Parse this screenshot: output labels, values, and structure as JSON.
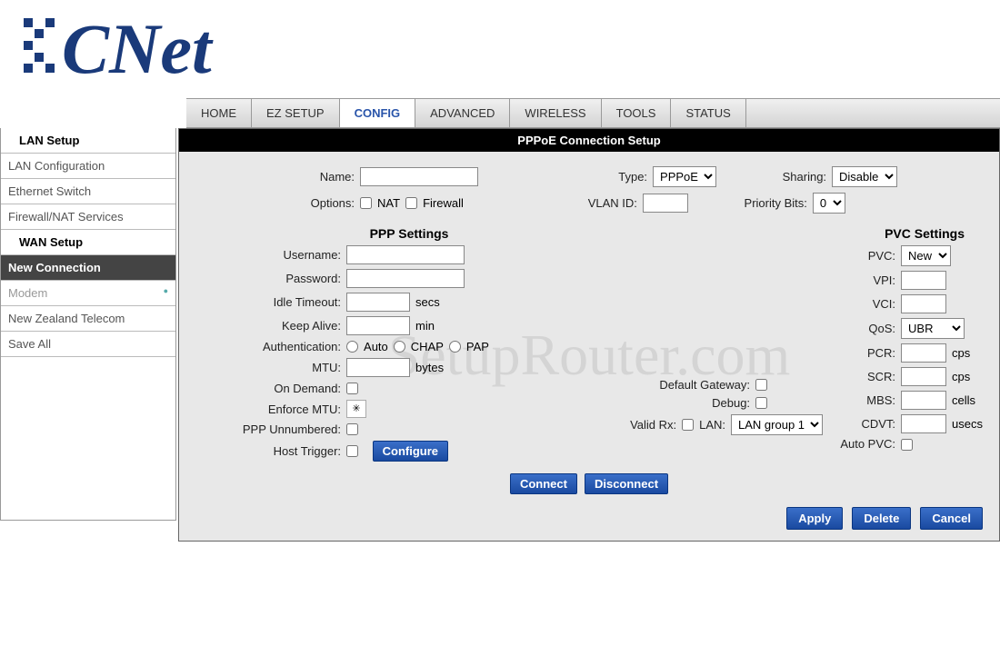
{
  "logo_text": "CNet",
  "nav": [
    "HOME",
    "EZ SETUP",
    "CONFIG",
    "ADVANCED",
    "WIRELESS",
    "TOOLS",
    "STATUS"
  ],
  "nav_active": "CONFIG",
  "sidebar": {
    "lan_hdr": "LAN Setup",
    "items1": [
      "LAN Configuration",
      "Ethernet Switch",
      "Firewall/NAT Services"
    ],
    "wan_hdr": "WAN Setup",
    "active": "New Connection",
    "items2": [
      "Modem",
      "New Zealand Telecom",
      "Save All"
    ]
  },
  "title": "PPPoE Connection Setup",
  "top": {
    "name_lbl": "Name:",
    "name_val": "",
    "type_lbl": "Type:",
    "type_val": "PPPoE",
    "sharing_lbl": "Sharing:",
    "sharing_val": "Disable",
    "options_lbl": "Options:",
    "nat_lbl": "NAT",
    "firewall_lbl": "Firewall",
    "vlan_lbl": "VLAN ID:",
    "vlan_val": "",
    "prio_lbl": "Priority Bits:",
    "prio_val": "0"
  },
  "ppp": {
    "hdr": "PPP Settings",
    "username_lbl": "Username:",
    "username_val": "",
    "password_lbl": "Password:",
    "password_val": "",
    "idle_lbl": "Idle Timeout:",
    "idle_val": "",
    "idle_unit": "secs",
    "keep_lbl": "Keep Alive:",
    "keep_val": "",
    "keep_unit": "min",
    "auth_lbl": "Authentication:",
    "auth_auto": "Auto",
    "auth_chap": "CHAP",
    "auth_pap": "PAP",
    "mtu_lbl": "MTU:",
    "mtu_val": "",
    "mtu_unit": "bytes",
    "ondemand_lbl": "On Demand:",
    "enforce_lbl": "Enforce MTU:",
    "unnum_lbl": "PPP Unnumbered:",
    "host_lbl": "Host Trigger:",
    "configure_btn": "Configure",
    "connect_btn": "Connect",
    "disconnect_btn": "Disconnect",
    "defgw_lbl": "Default Gateway:",
    "debug_lbl": "Debug:",
    "validrx_lbl": "Valid Rx:",
    "lan_lbl": "LAN:",
    "lan_val": "LAN group 1"
  },
  "pvc": {
    "hdr": "PVC Settings",
    "pvc_lbl": "PVC:",
    "pvc_val": "New",
    "vpi_lbl": "VPI:",
    "vpi_val": "",
    "vci_lbl": "VCI:",
    "vci_val": "",
    "qos_lbl": "QoS:",
    "qos_val": "UBR",
    "pcr_lbl": "PCR:",
    "pcr_val": "",
    "pcr_unit": "cps",
    "scr_lbl": "SCR:",
    "scr_val": "",
    "scr_unit": "cps",
    "mbs_lbl": "MBS:",
    "mbs_val": "",
    "mbs_unit": "cells",
    "cdvt_lbl": "CDVT:",
    "cdvt_val": "",
    "cdvt_unit": "usecs",
    "auto_lbl": "Auto PVC:"
  },
  "buttons": {
    "apply": "Apply",
    "delete": "Delete",
    "cancel": "Cancel"
  },
  "watermark": "SetupRouter.com"
}
